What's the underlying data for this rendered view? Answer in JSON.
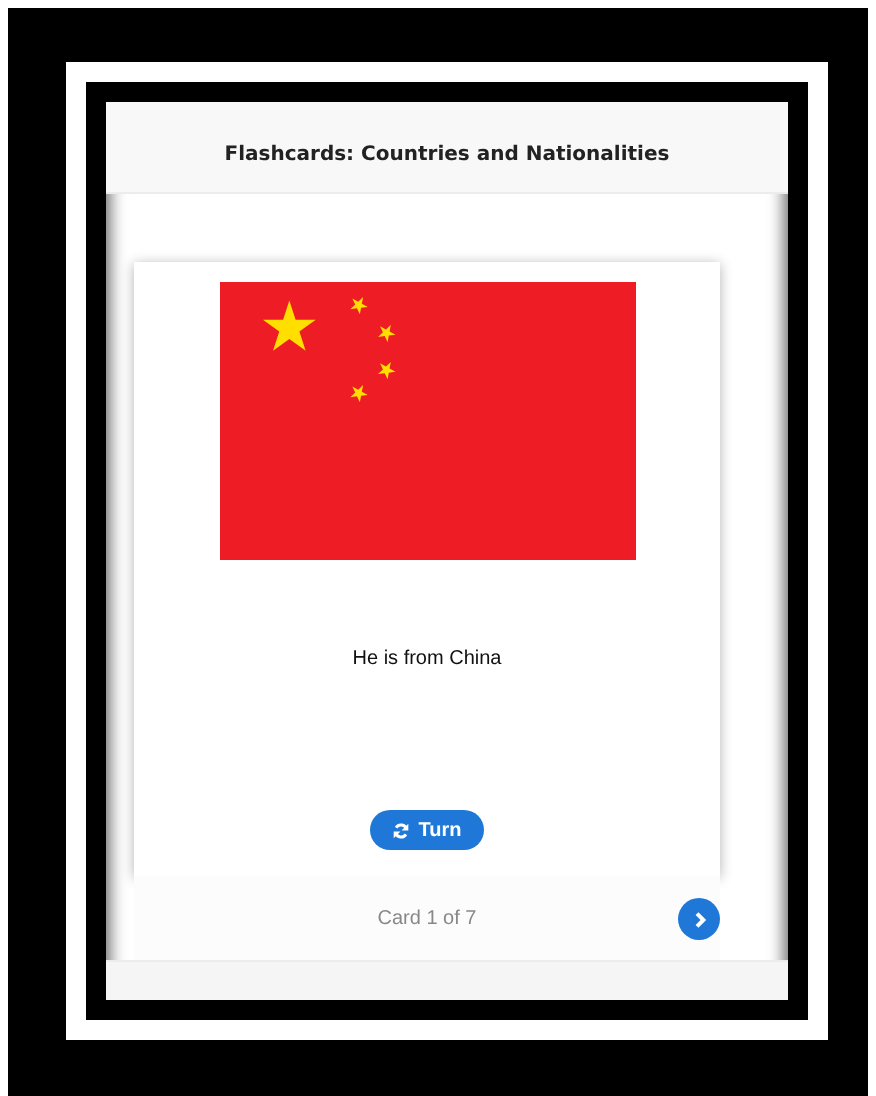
{
  "header": {
    "title": "Flashcards: Countries and Nationalities"
  },
  "card": {
    "sentence": "He is from China",
    "turn_button": {
      "label": "Turn"
    }
  },
  "footer": {
    "counter": "Card 1 of 7"
  }
}
